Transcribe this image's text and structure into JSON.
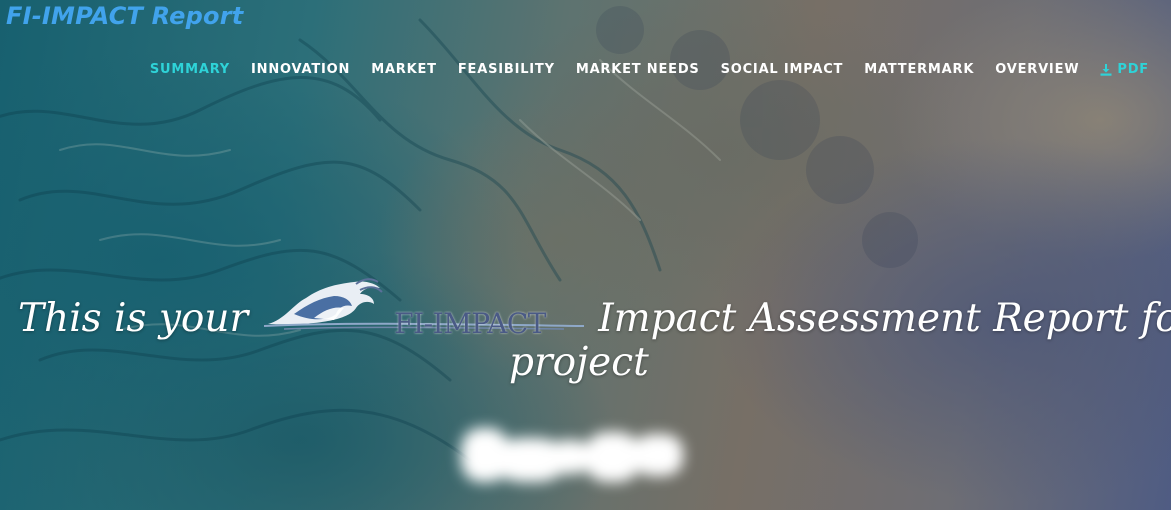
{
  "app": {
    "brand": "FI-IMPACT Report"
  },
  "nav": {
    "items": [
      {
        "label": "SUMMARY",
        "active": true
      },
      {
        "label": "INNOVATION"
      },
      {
        "label": "MARKET"
      },
      {
        "label": "FEASIBILITY"
      },
      {
        "label": "MARKET NEEDS"
      },
      {
        "label": "SOCIAL IMPACT"
      },
      {
        "label": "MATTERMARK"
      },
      {
        "label": "OVERVIEW"
      }
    ],
    "pdf": {
      "label": "PDF",
      "icon": "download-icon"
    }
  },
  "hero": {
    "line1_before": "This is your",
    "logo_text": "FI-IMPACT",
    "line1_after": "Impact Assessment Report for",
    "line2": "project",
    "project_name_blurred": true
  },
  "colors": {
    "brand": "#41a3ec",
    "accent": "#2ed3d8",
    "nav_text": "#ffffff",
    "logo_text": "#4a5a86"
  }
}
